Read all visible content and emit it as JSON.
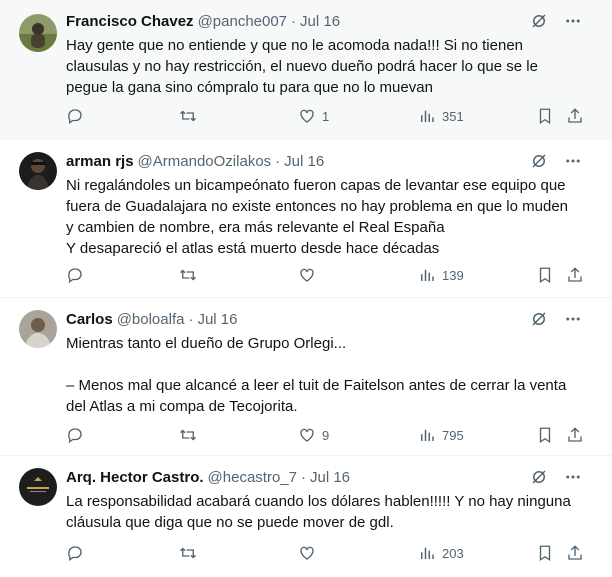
{
  "tweets": [
    {
      "name": "Francisco Chavez",
      "handle": "@panche007",
      "separator": "·",
      "date": "Jul 16",
      "text": "Hay gente que no entiende y que no le acomoda nada!!! Si no tienen\nclausulas y no hay restricción, el nuevo dueño podrá hacer lo que se le\npegue la gana sino cómpralo tu para que no lo muevan",
      "likes": "1",
      "views": "351"
    },
    {
      "name": "arman rjs",
      "handle": "@ArmandoOzilakos",
      "separator": "·",
      "date": "Jul 16",
      "text": "Ni regalándoles un bicampeónato fueron capas de levantar ese equipo que\nfuera de Guadalajara no existe entonces no hay problema en que lo muden\ny cambien de nombre, era más relevante el Real España\nY desapareció el atlas está muerto desde hace décadas",
      "likes": "",
      "views": "139"
    },
    {
      "name": "Carlos",
      "handle": "@boloalfa",
      "separator": "·",
      "date": "Jul 16",
      "text": "Mientras tanto el dueño de Grupo Orlegi...\n\n– Menos mal que alcancé a leer el tuit de Faitelson antes de cerrar la venta\ndel Atlas a mi compa de Tecojorita.",
      "likes": "9",
      "views": "795"
    },
    {
      "name": "Arq. Hector Castro.",
      "handle": "@hecastro_7",
      "separator": "·",
      "date": "Jul 16",
      "text": "La responsabilidad acabará cuando los dólares hablen!!!!! Y no hay ninguna\ncláusula que diga que no se puede mover de gdl.",
      "likes": "",
      "views": "203"
    }
  ],
  "icons": {
    "grok": "grok-icon",
    "more": "more-icon",
    "reply": "reply-icon",
    "retweet": "retweet-icon",
    "like": "like-icon",
    "views": "views-icon",
    "bookmark": "bookmark-icon",
    "share": "share-icon"
  },
  "colors": {
    "text": "#0f1419",
    "secondary": "#536471",
    "divider": "#eff3f4",
    "hover_bg": "#f7f9f9"
  }
}
